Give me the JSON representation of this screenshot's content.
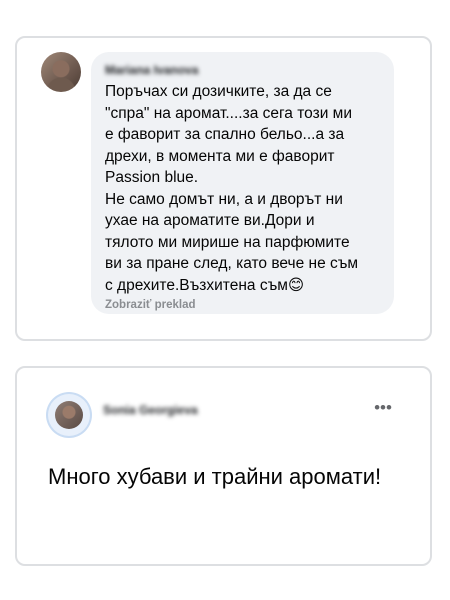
{
  "comment": {
    "author": "Mariana Ivanova",
    "text": "Поръчах си дозичките, за да се\n\"спра\" на аромат....за сега този ми\nе фаворит за спално бельо...а за\nдрехи, в момента ми е фаворит\nPassion blue.\nНе само домът ни, а и дворът ни\nухае на ароматите ви.Дори и\nтялото ми мирише на парфюмите\nви за пране след, като вече не съм\nс дрехите.Възхитена съм😊",
    "translate_label": "Zobraziť preklad"
  },
  "post": {
    "author": "Sonia Georgieva",
    "more_label": "•••",
    "text": "Много хубави и трайни аромати!"
  },
  "icons": {
    "avatar_1": "user-avatar",
    "avatar_2": "user-avatar",
    "more": "more-options-icon"
  }
}
